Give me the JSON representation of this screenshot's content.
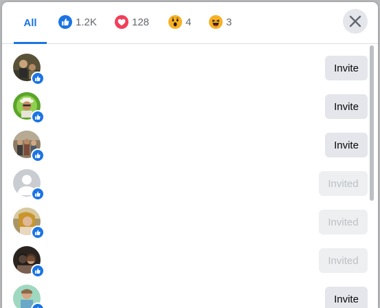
{
  "tabs": {
    "all_label": "All",
    "like_count": "1.2K",
    "love_count": "128",
    "wow_count": "4",
    "haha_count": "3"
  },
  "reaction_icons": {
    "like": "like-icon",
    "love": "heart-icon",
    "wow": "wow-face-icon",
    "haha": "haha-face-icon"
  },
  "people": [
    {
      "name": "",
      "action": "Invite",
      "state": "invite",
      "avatar": "photo-1"
    },
    {
      "name": "",
      "action": "Invite",
      "state": "invite",
      "avatar": "photo-2"
    },
    {
      "name": "",
      "action": "Invite",
      "state": "invite",
      "avatar": "photo-3"
    },
    {
      "name": "",
      "action": "Invited",
      "state": "invited",
      "avatar": "default-silhouette"
    },
    {
      "name": "",
      "action": "Invited",
      "state": "invited",
      "avatar": "photo-5"
    },
    {
      "name": "",
      "action": "Invited",
      "state": "invited",
      "avatar": "photo-6"
    },
    {
      "name": "",
      "action": "Invite",
      "state": "invite",
      "avatar": "photo-7"
    }
  ],
  "colors": {
    "accent": "#1b74e4",
    "button_bg": "#e4e6eb",
    "disabled_text": "#bcc0c4",
    "love": "#f33e58",
    "wow_face": "#f7b125"
  }
}
